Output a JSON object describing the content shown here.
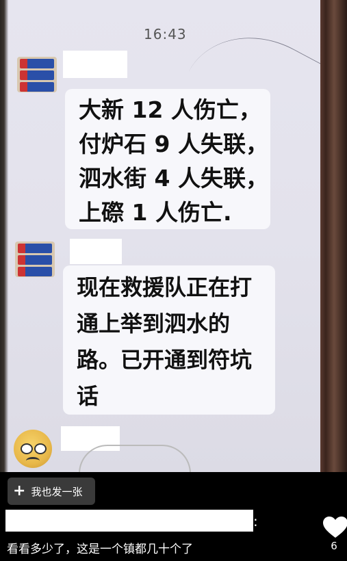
{
  "chat": {
    "time": "16:43",
    "message1_lines": [
      "大新 12 人伤亡，",
      "付炉石 9 人失联，",
      "泗水街 4 人失联，",
      "上磜 1 人伤亡."
    ],
    "message2_lines": [
      "现在救援队正在打",
      "通上举到泗水的",
      "路。已开通到符坑",
      "话"
    ]
  },
  "post": {
    "share_button_label": "我也发一张",
    "separator": ":",
    "comment_text": "看看多少了，这是一个镇都几十个了",
    "like_count": "6"
  },
  "colors": {
    "background": "#000000",
    "bubble": "#f7f7fb",
    "button": "#3a3a3a"
  }
}
